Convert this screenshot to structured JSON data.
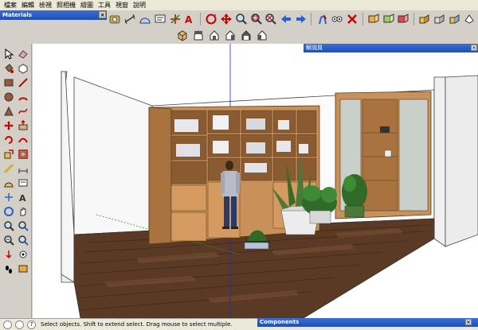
{
  "menu": {
    "items": [
      "檔案",
      "編輯",
      "檢視",
      "照相機",
      "繪圖",
      "工具",
      "視窗",
      "說明"
    ]
  },
  "materials_window": {
    "title": "Materials",
    "close": "×"
  },
  "info_window": {
    "title": "解說員",
    "close": "×"
  },
  "components_window": {
    "title": "Components",
    "close": "×"
  },
  "status": {
    "help_icon": "?",
    "text": "Select objects. Shift to extend select. Drag mouse to select multiple."
  },
  "colors": {
    "titlebar": "#1c4fb8",
    "floor": "#5a3a24",
    "wall": "#f4f4f4",
    "bookcase": "#c8915a"
  }
}
